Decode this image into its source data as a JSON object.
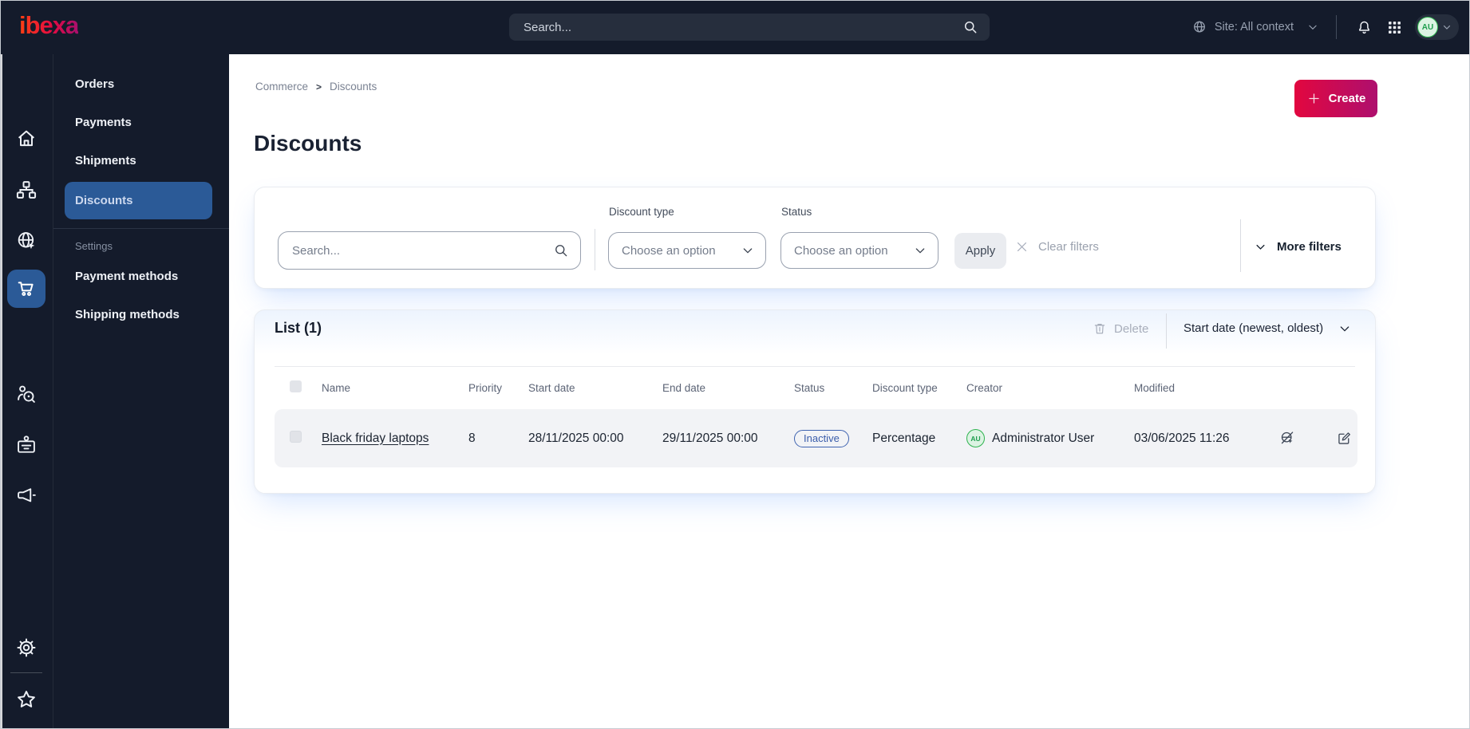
{
  "topbar": {
    "logo_text": "ibexa",
    "search_placeholder": "Search...",
    "site_context_label": "Site: All context",
    "avatar_initials": "AU"
  },
  "nav_rail": {
    "items": [
      "home",
      "content-tree",
      "site",
      "products",
      "commerce",
      "customers",
      "corporate",
      "marketing"
    ],
    "active_item": "commerce",
    "bottom_items": [
      "settings",
      "bookmarks"
    ]
  },
  "sidebar": {
    "items": [
      {
        "label": "Orders",
        "active": false
      },
      {
        "label": "Payments",
        "active": false
      },
      {
        "label": "Shipments",
        "active": false
      },
      {
        "label": "Discounts",
        "active": true
      }
    ],
    "section_label": "Settings",
    "section_items": [
      {
        "label": "Payment methods"
      },
      {
        "label": "Shipping methods"
      }
    ]
  },
  "breadcrumb": {
    "items": [
      "Commerce",
      "Discounts"
    ],
    "separator": ">"
  },
  "page": {
    "title": "Discounts",
    "create_label": "Create"
  },
  "filters": {
    "search_placeholder": "Search...",
    "discount_type_label": "Discount type",
    "discount_type_value": "Choose an option",
    "status_label": "Status",
    "status_value": "Choose an option",
    "apply_label": "Apply",
    "clear_filters_label": "Clear filters",
    "more_filters_label": "More filters"
  },
  "list": {
    "title": "List (1)",
    "delete_label": "Delete",
    "sort_label": "Start date (newest, oldest)",
    "columns": [
      "Name",
      "Priority",
      "Start date",
      "End date",
      "Status",
      "Discount type",
      "Creator",
      "Modified"
    ],
    "rows": [
      {
        "name": "Black friday laptops",
        "priority": "8",
        "start_date": "28/11/2025 00:00",
        "end_date": "29/11/2025 00:00",
        "status": "Inactive",
        "discount_type": "Percentage",
        "creator_initials": "AU",
        "creator": "Administrator User",
        "modified": "03/06/2025 11:26"
      }
    ]
  },
  "colors": {
    "topbar_bg": "#141b2b",
    "active_blue": "#2b5a97",
    "accent_gradient_start": "#e2073f",
    "accent_gradient_end": "#ae0f6e",
    "status_badge_blue": "#3f63b0",
    "avatar_green": "#2fb34f",
    "row_bg": "#f2f3f6"
  }
}
